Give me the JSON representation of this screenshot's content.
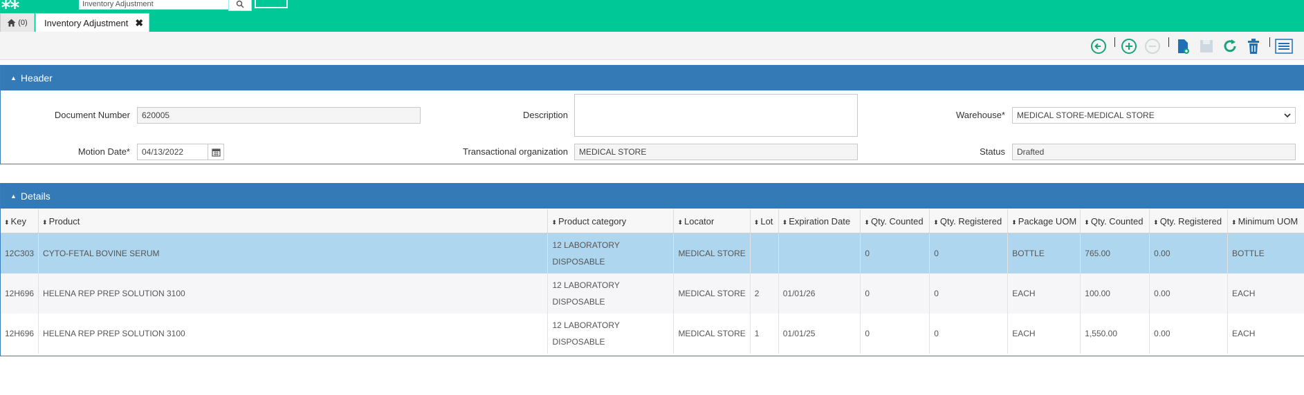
{
  "app": {
    "search_placeholder": "Inventory Adjustment"
  },
  "tabs": {
    "home_count": "(0)",
    "active_label": "Inventory Adjustment",
    "close_glyph": "✖"
  },
  "toolbar": {
    "icons": [
      "back-icon",
      "add-icon",
      "remove-icon",
      "new-document-icon",
      "save-icon",
      "refresh-icon",
      "delete-icon",
      "list-view-icon"
    ]
  },
  "header_section": {
    "title": "Header",
    "document_number_label": "Document Number",
    "document_number_value": "620005",
    "description_label": "Description",
    "description_value": "",
    "warehouse_label": "Warehouse*",
    "warehouse_value": "MEDICAL STORE-MEDICAL STORE",
    "motion_date_label": "Motion Date*",
    "motion_date_value": "04/13/2022",
    "transactional_org_label": "Transactional organization",
    "transactional_org_value": "MEDICAL STORE",
    "status_label": "Status",
    "status_value": "Drafted"
  },
  "details_section": {
    "title": "Details",
    "columns": [
      "Key",
      "Product",
      "Product category",
      "Locator",
      "Lot",
      "Expiration Date",
      "Qty. Counted",
      "Qty. Registered",
      "Package UOM",
      "Qty. Counted",
      "Qty. Registered",
      "Minimum UOM"
    ],
    "rows": [
      {
        "key": "12C303",
        "product": "CYTO-FETAL BOVINE SERUM",
        "category_line1": "12 LABORATORY",
        "category_line2": "DISPOSABLE",
        "locator": "MEDICAL STORE",
        "lot": "",
        "expiration": "",
        "qty_counted": "0",
        "qty_registered": "0",
        "package_uom": "BOTTLE",
        "qty_counted2": "765.00",
        "qty_registered2": "0.00",
        "minimum_uom": "BOTTLE"
      },
      {
        "key": "12H696",
        "product": "HELENA REP PREP SOLUTION 3100",
        "category_line1": "12 LABORATORY",
        "category_line2": "DISPOSABLE",
        "locator": "MEDICAL STORE",
        "lot": "2",
        "expiration": "01/01/26",
        "qty_counted": "0",
        "qty_registered": "0",
        "package_uom": "EACH",
        "qty_counted2": "100.00",
        "qty_registered2": "0.00",
        "minimum_uom": "EACH"
      },
      {
        "key": "12H696",
        "product": "HELENA REP PREP SOLUTION 3100",
        "category_line1": "12 LABORATORY",
        "category_line2": "DISPOSABLE",
        "locator": "MEDICAL STORE",
        "lot": "1",
        "expiration": "01/01/25",
        "qty_counted": "0",
        "qty_registered": "0",
        "package_uom": "EACH",
        "qty_counted2": "1,550.00",
        "qty_registered2": "0.00",
        "minimum_uom": "EACH"
      }
    ]
  },
  "colors": {
    "topbar": "#00c997",
    "panel_header": "#337ab7",
    "selected_row": "#aed6ee",
    "toolbar_icon": "#19a17a",
    "toolbar_icon_blue": "#1f6fb5"
  }
}
